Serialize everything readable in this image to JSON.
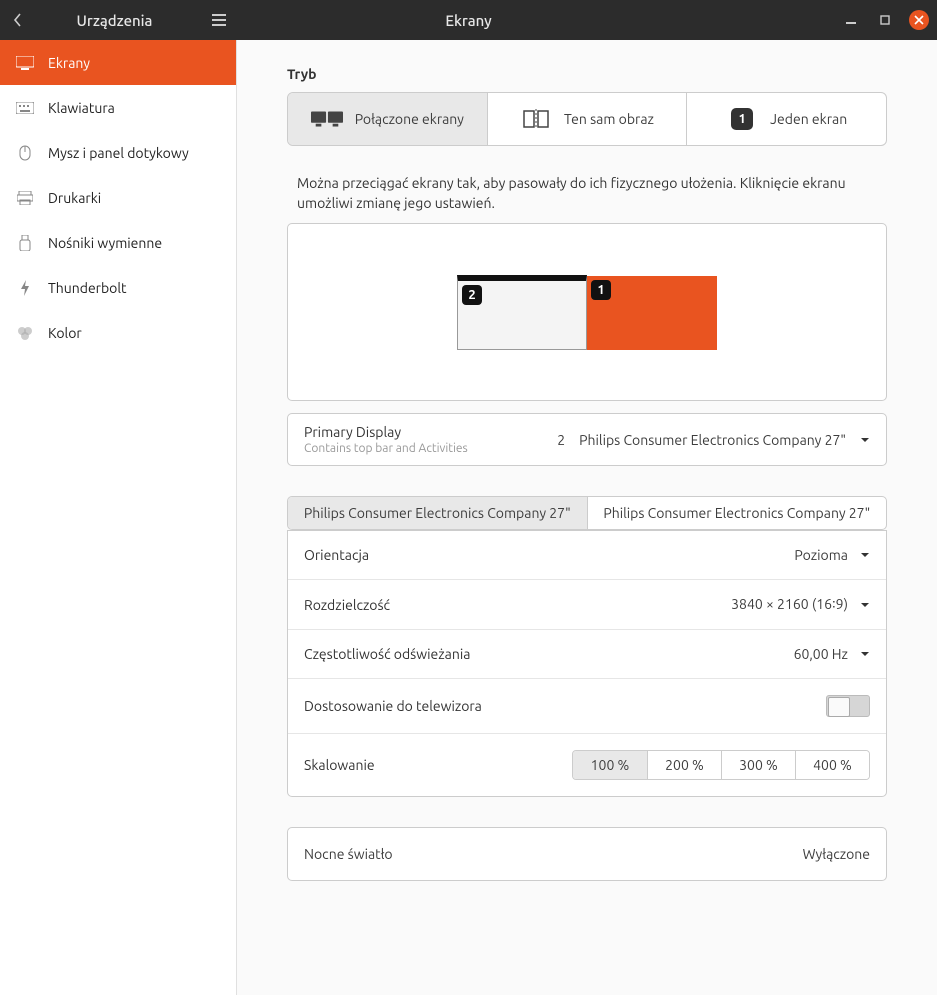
{
  "header": {
    "sidebar_title": "Urządzenia",
    "panel_title": "Ekrany"
  },
  "sidebar": {
    "items": [
      {
        "label": "Ekrany"
      },
      {
        "label": "Klawiatura"
      },
      {
        "label": "Mysz i panel dotykowy"
      },
      {
        "label": "Drukarki"
      },
      {
        "label": "Nośniki wymienne"
      },
      {
        "label": "Thunderbolt"
      },
      {
        "label": "Kolor"
      }
    ]
  },
  "mode": {
    "section_label": "Tryb",
    "options": [
      {
        "label": "Połączone ekrany"
      },
      {
        "label": "Ten sam obraz"
      },
      {
        "label": "Jeden ekran"
      }
    ]
  },
  "help_text": "Można przeciągać ekrany tak, aby pasowały do ich fizycznego ułożenia. Kliknięcie ekranu umożliwi zmianę jego ustawień.",
  "monitors": {
    "badge1": "1",
    "badge2": "2"
  },
  "primary": {
    "title": "Primary Display",
    "subtitle": "Contains top bar and Activities",
    "value_num": "2",
    "value_name": "Philips Consumer Electronics Company 27\""
  },
  "display_tabs": [
    {
      "label": "Philips Consumer Electronics Company 27\""
    },
    {
      "label": "Philips Consumer Electronics Company 27\""
    }
  ],
  "settings": {
    "orientation": {
      "label": "Orientacja",
      "value": "Pozioma"
    },
    "resolution": {
      "label": "Rozdzielczość",
      "value": "3840 × 2160 (16∶9)"
    },
    "refresh": {
      "label": "Częstotliwość odświeżania",
      "value": "60,00 Hz"
    },
    "tv": {
      "label": "Dostosowanie do telewizora"
    },
    "scaling": {
      "label": "Skalowanie",
      "options": [
        "100 %",
        "200 %",
        "300 %",
        "400 %"
      ]
    }
  },
  "nightlight": {
    "label": "Nocne światło",
    "value": "Wyłączone"
  }
}
